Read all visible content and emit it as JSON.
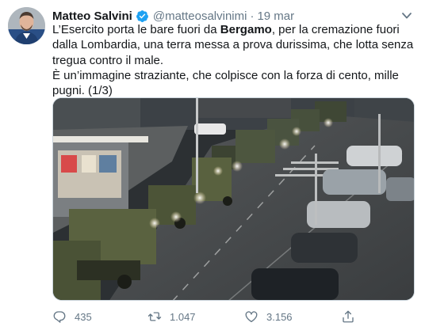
{
  "tweet": {
    "author_name": "Matteo Salvini",
    "handle": "@matteosalvinimi",
    "separator": "·",
    "date": "19 mar",
    "text_part1": "L’Esercito porta le bare fuori da ",
    "text_bold": "Bergamo",
    "text_part2": ", per la cremazione fuori dalla Lombardia, una terra messa a prova durissima, che lotta senza tregua contro il male.",
    "text_line2": "È un’immagine straziante, che colpisce con la forza di cento, mille pugni. (1/3)"
  },
  "actions": {
    "replies": "435",
    "retweets": "1.047",
    "likes": "3.156"
  },
  "icons": {
    "reply": "reply-icon",
    "retweet": "retweet-icon",
    "like": "heart-icon",
    "share": "share-icon",
    "verified": "verified-badge-icon",
    "menu": "chevron-down-icon"
  },
  "colors": {
    "text": "#14171a",
    "secondary": "#657786",
    "verified": "#1da1f2"
  }
}
